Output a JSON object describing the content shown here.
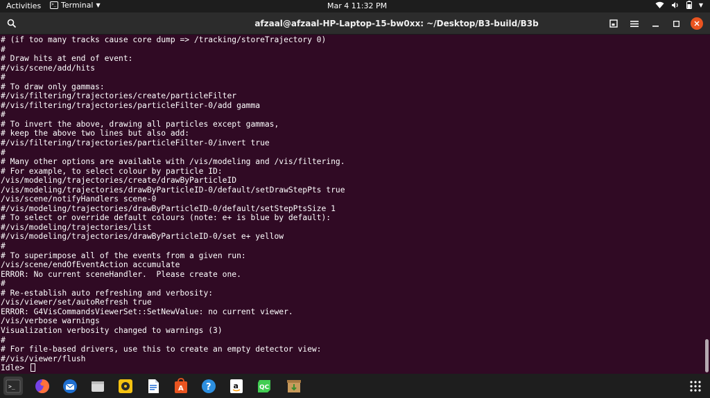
{
  "topbar": {
    "activities": "Activities",
    "app_name": "Terminal",
    "clock": "Mar 4  11:32 PM"
  },
  "window": {
    "title": "afzaal@afzaal-HP-Laptop-15-bw0xx: ~/Desktop/B3-build/B3b"
  },
  "terminal": {
    "lines": [
      "# (if too many tracks cause core dump => /tracking/storeTrajectory 0)",
      "#",
      "# Draw hits at end of event:",
      "#/vis/scene/add/hits",
      "#",
      "# To draw only gammas:",
      "#/vis/filtering/trajectories/create/particleFilter",
      "#/vis/filtering/trajectories/particleFilter-0/add gamma",
      "#",
      "# To invert the above, drawing all particles except gammas,",
      "# keep the above two lines but also add:",
      "#/vis/filtering/trajectories/particleFilter-0/invert true",
      "#",
      "# Many other options are available with /vis/modeling and /vis/filtering.",
      "# For example, to select colour by particle ID:",
      "/vis/modeling/trajectories/create/drawByParticleID",
      "/vis/modeling/trajectories/drawByParticleID-0/default/setDrawStepPts true",
      "/vis/scene/notifyHandlers scene-0",
      "#/vis/modeling/trajectories/drawByParticleID-0/default/setStepPtsSize 1",
      "# To select or override default colours (note: e+ is blue by default):",
      "#/vis/modeling/trajectories/list",
      "#/vis/modeling/trajectories/drawByParticleID-0/set e+ yellow",
      "#",
      "# To superimpose all of the events from a given run:",
      "/vis/scene/endOfEventAction accumulate",
      "ERROR: No current sceneHandler.  Please create one.",
      "#",
      "# Re-establish auto refreshing and verbosity:",
      "/vis/viewer/set/autoRefresh true",
      "ERROR: G4VisCommandsViewerSet::SetNewValue: no current viewer.",
      "/vis/verbose warnings",
      "Visualization verbosity changed to warnings (3)",
      "#",
      "# For file-based drivers, use this to create an empty detector view:",
      "#/vis/viewer/flush"
    ],
    "prompt": "Idle> "
  },
  "dock": {
    "items": [
      {
        "name": "terminal-icon"
      },
      {
        "name": "firefox-icon"
      },
      {
        "name": "thunderbird-icon"
      },
      {
        "name": "files-icon"
      },
      {
        "name": "rhythmbox-icon"
      },
      {
        "name": "writer-icon"
      },
      {
        "name": "software-center-icon"
      },
      {
        "name": "help-icon"
      },
      {
        "name": "amazon-icon"
      },
      {
        "name": "qt-creator-icon"
      },
      {
        "name": "archive-manager-icon"
      },
      {
        "name": "show-apps-icon"
      }
    ]
  },
  "colors": {
    "terminal_bg": "#300a24",
    "accent": "#e95420"
  }
}
